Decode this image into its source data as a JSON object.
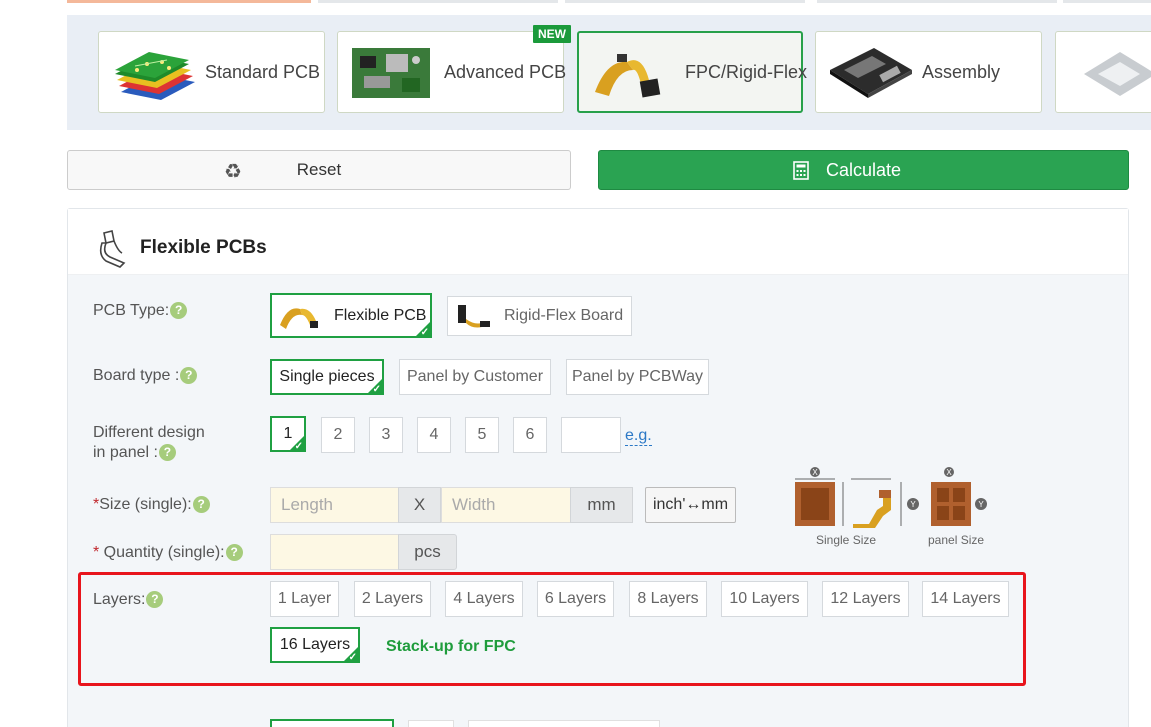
{
  "tabs": [
    {
      "label": "Standard PCB",
      "icon": "standard-pcb-image"
    },
    {
      "label": "Advanced PCB",
      "icon": "advanced-pcb-image",
      "badge": "NEW"
    },
    {
      "label": "FPC/Rigid-Flex",
      "icon": "fpc-image",
      "active": true
    },
    {
      "label": "Assembly",
      "icon": "assembly-image"
    }
  ],
  "actions": {
    "reset": "Reset",
    "calculate": "Calculate"
  },
  "panel": {
    "title": "Flexible PCBs",
    "pcb_type": {
      "label": "PCB Type:",
      "options": [
        "Flexible PCB",
        "Rigid-Flex Board"
      ],
      "selected": "Flexible PCB"
    },
    "board_type": {
      "label": "Board type :",
      "options": [
        "Single pieces",
        "Panel by Customer",
        "Panel by PCBWay"
      ],
      "selected": "Single pieces"
    },
    "designs": {
      "label_line1": "Different design",
      "label_line2": "in panel :",
      "options": [
        "1",
        "2",
        "3",
        "4",
        "5",
        "6"
      ],
      "selected": "1",
      "custom_value": "",
      "eg": "e.g."
    },
    "size": {
      "label": "Size (single):",
      "length_placeholder": "Length",
      "sep": "X",
      "width_placeholder": "Width",
      "unit": "mm",
      "toggle": "inch'↔mm"
    },
    "quantity": {
      "label": " Quantity (single):",
      "unit": "pcs"
    },
    "layers": {
      "label": "Layers:",
      "options": [
        "1 Layer",
        "2 Layers",
        "4 Layers",
        "6 Layers",
        "8 Layers",
        "10 Layers",
        "12 Layers",
        "14 Layers",
        "16 Layers"
      ],
      "selected": "16 Layers",
      "stackup_link": "Stack-up for FPC"
    },
    "diagram": {
      "single_label": "Single Size",
      "panel_label": "panel Size"
    }
  },
  "colors": {
    "accent": "#2aa352",
    "highlight": "#e8141c"
  }
}
